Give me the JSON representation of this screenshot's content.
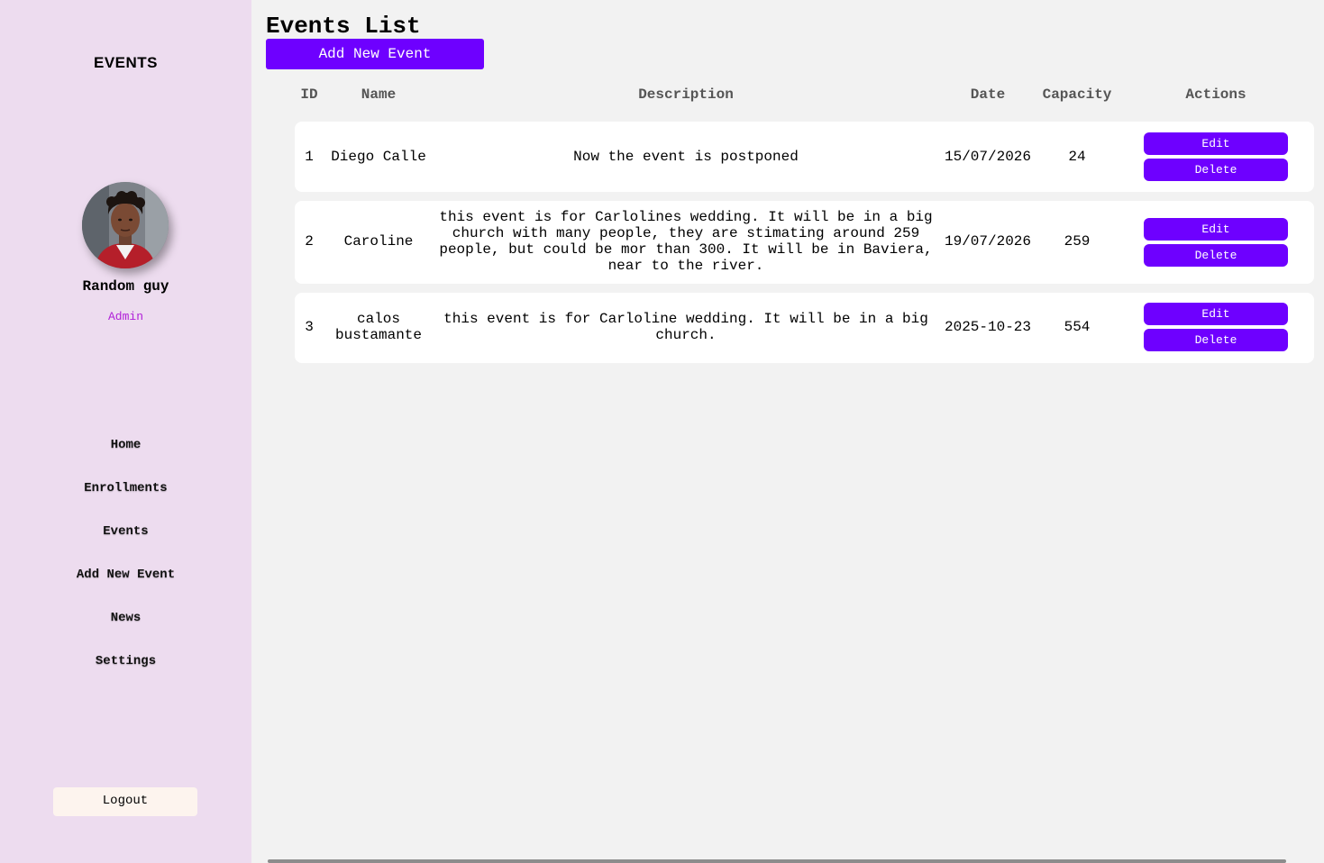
{
  "sidebar": {
    "brand": "EVENTS",
    "user": {
      "name": "Random guy",
      "role": "Admin"
    },
    "nav": [
      {
        "label": "Home"
      },
      {
        "label": "Enrollments"
      },
      {
        "label": "Events"
      },
      {
        "label": "Add New Event"
      },
      {
        "label": "News"
      },
      {
        "label": "Settings"
      }
    ],
    "logout_label": "Logout"
  },
  "main": {
    "title": "Events List",
    "add_button": "Add New Event",
    "columns": {
      "id": "ID",
      "name": "Name",
      "description": "Description",
      "date": "Date",
      "capacity": "Capacity",
      "actions": "Actions"
    },
    "rows": [
      {
        "id": "1",
        "name": "Diego Calle",
        "description": "Now the event is postponed",
        "date": "15/07/2026",
        "capacity": "24",
        "edit": "Edit",
        "delete": "Delete"
      },
      {
        "id": "2",
        "name": "Caroline",
        "description": "this event is for Carlolines wedding. It will be in a big church with many people, they are stimating around 259 people, but could be mor than 300. It will be in Baviera, near to the river.",
        "date": "19/07/2026",
        "capacity": "259",
        "edit": "Edit",
        "delete": "Delete"
      },
      {
        "id": "3",
        "name": "calos bustamante",
        "description": "this event is for Carloline wedding. It will be in a big church.",
        "date": "2025-10-23",
        "capacity": "554",
        "edit": "Edit",
        "delete": "Delete"
      }
    ]
  },
  "colors": {
    "sidebar_bg": "#eddcef",
    "accent": "#6e00ff",
    "role_text": "#b020d8",
    "page_bg": "#f2f2f2"
  }
}
